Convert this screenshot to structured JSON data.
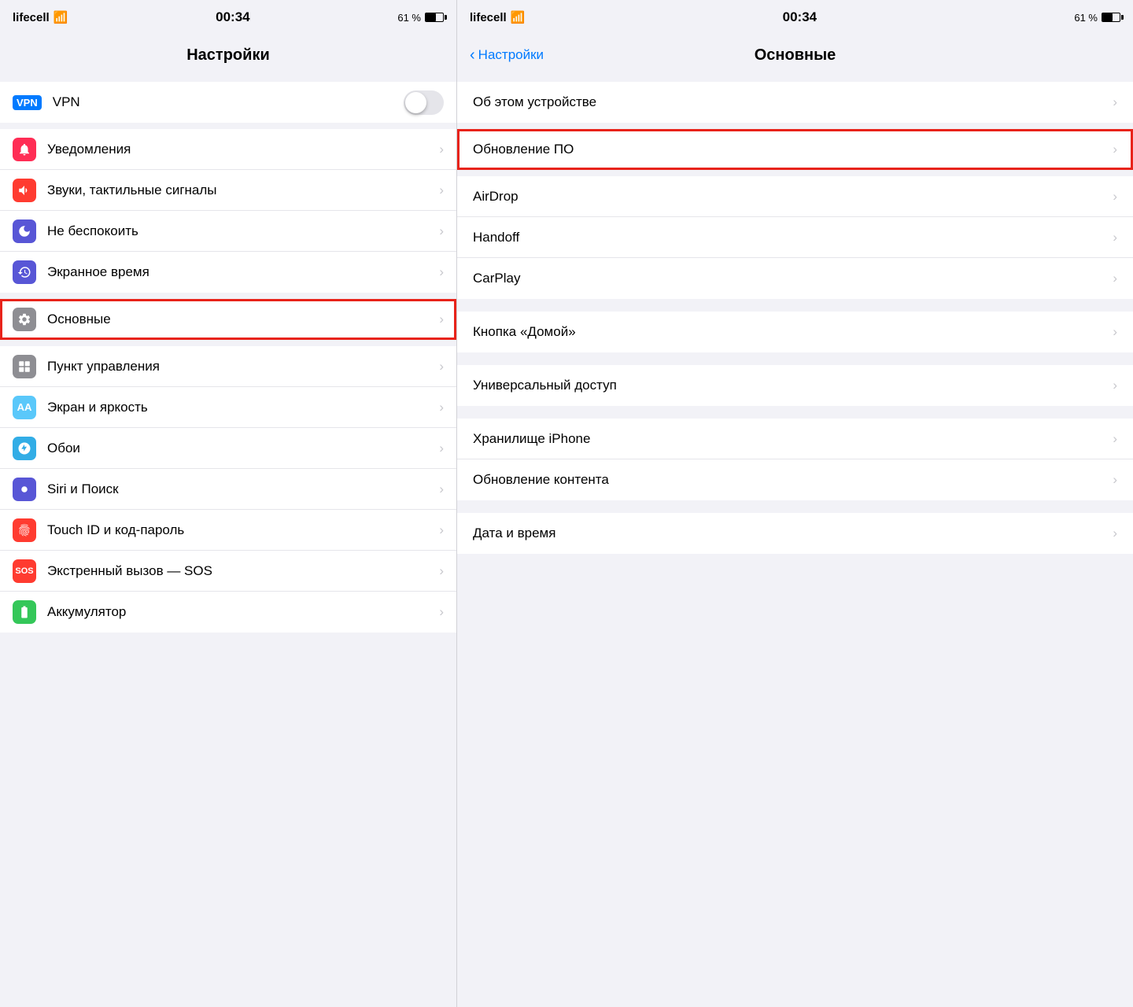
{
  "left": {
    "statusBar": {
      "carrier": "lifecell",
      "wifi": true,
      "time": "00:34",
      "batteryPercent": "61 %"
    },
    "title": "Настройки",
    "sections": [
      {
        "id": "vpn",
        "rows": [
          {
            "id": "vpn",
            "icon": "vpn",
            "label": "VPN",
            "toggle": true,
            "iconColor": "icon-blue"
          }
        ]
      },
      {
        "id": "notifications",
        "rows": [
          {
            "id": "notifications",
            "icon": "🔔",
            "label": "Уведомления",
            "chevron": true,
            "iconColor": "icon-red2"
          },
          {
            "id": "sounds",
            "icon": "🔊",
            "label": "Звуки, тактильные сигналы",
            "chevron": true,
            "iconColor": "icon-red"
          },
          {
            "id": "dnd",
            "icon": "🌙",
            "label": "Не беспокоить",
            "chevron": true,
            "iconColor": "icon-indigo"
          },
          {
            "id": "screentime",
            "icon": "⏳",
            "label": "Экранное время",
            "chevron": true,
            "iconColor": "icon-indigo"
          }
        ]
      },
      {
        "id": "general",
        "highlighted": true,
        "rows": [
          {
            "id": "general",
            "icon": "⚙️",
            "label": "Основные",
            "chevron": true,
            "iconColor": "icon-gray",
            "highlighted": true
          }
        ]
      },
      {
        "id": "more",
        "rows": [
          {
            "id": "controlcenter",
            "icon": "⏺",
            "label": "Пункт управления",
            "chevron": true,
            "iconColor": "icon-gray"
          },
          {
            "id": "display",
            "icon": "AA",
            "label": "Экран и яркость",
            "chevron": true,
            "iconColor": "icon-blue2"
          },
          {
            "id": "wallpaper",
            "icon": "❋",
            "label": "Обои",
            "chevron": true,
            "iconColor": "icon-teal"
          },
          {
            "id": "siri",
            "icon": "◎",
            "label": "Siri и Поиск",
            "chevron": true,
            "iconColor": "icon-indigo"
          },
          {
            "id": "touchid",
            "icon": "◉",
            "label": "Touch ID и код-пароль",
            "chevron": true,
            "iconColor": "icon-red"
          },
          {
            "id": "sos",
            "icon": "SOS",
            "label": "Экстренный вызов — SOS",
            "chevron": true,
            "iconColor": "icon-red"
          },
          {
            "id": "battery",
            "icon": "🔋",
            "label": "Аккумулятор",
            "chevron": true,
            "iconColor": "icon-green"
          }
        ]
      }
    ]
  },
  "right": {
    "statusBar": {
      "carrier": "lifecell",
      "wifi": true,
      "time": "00:34",
      "batteryPercent": "61 %"
    },
    "backLabel": "Настройки",
    "title": "Основные",
    "sections": [
      {
        "id": "device",
        "rows": [
          {
            "id": "about",
            "label": "Об этом устройстве",
            "chevron": true
          }
        ]
      },
      {
        "id": "update",
        "highlighted": true,
        "rows": [
          {
            "id": "software-update",
            "label": "Обновление ПО",
            "chevron": true,
            "highlighted": true
          }
        ]
      },
      {
        "id": "connectivity",
        "rows": [
          {
            "id": "airdrop",
            "label": "AirDrop",
            "chevron": true
          },
          {
            "id": "handoff",
            "label": "Handoff",
            "chevron": true
          },
          {
            "id": "carplay",
            "label": "CarPlay",
            "chevron": true
          }
        ]
      },
      {
        "id": "hardware",
        "rows": [
          {
            "id": "homebutton",
            "label": "Кнопка «Домой»",
            "chevron": true
          }
        ]
      },
      {
        "id": "accessibility",
        "rows": [
          {
            "id": "accessibility",
            "label": "Универсальный доступ",
            "chevron": true
          }
        ]
      },
      {
        "id": "storage",
        "rows": [
          {
            "id": "storage",
            "label": "Хранилище iPhone",
            "chevron": true
          },
          {
            "id": "bgrefresh",
            "label": "Обновление контента",
            "chevron": true
          }
        ]
      },
      {
        "id": "datetime",
        "rows": [
          {
            "id": "datetime",
            "label": "Дата и время",
            "chevron": true
          }
        ]
      }
    ]
  }
}
